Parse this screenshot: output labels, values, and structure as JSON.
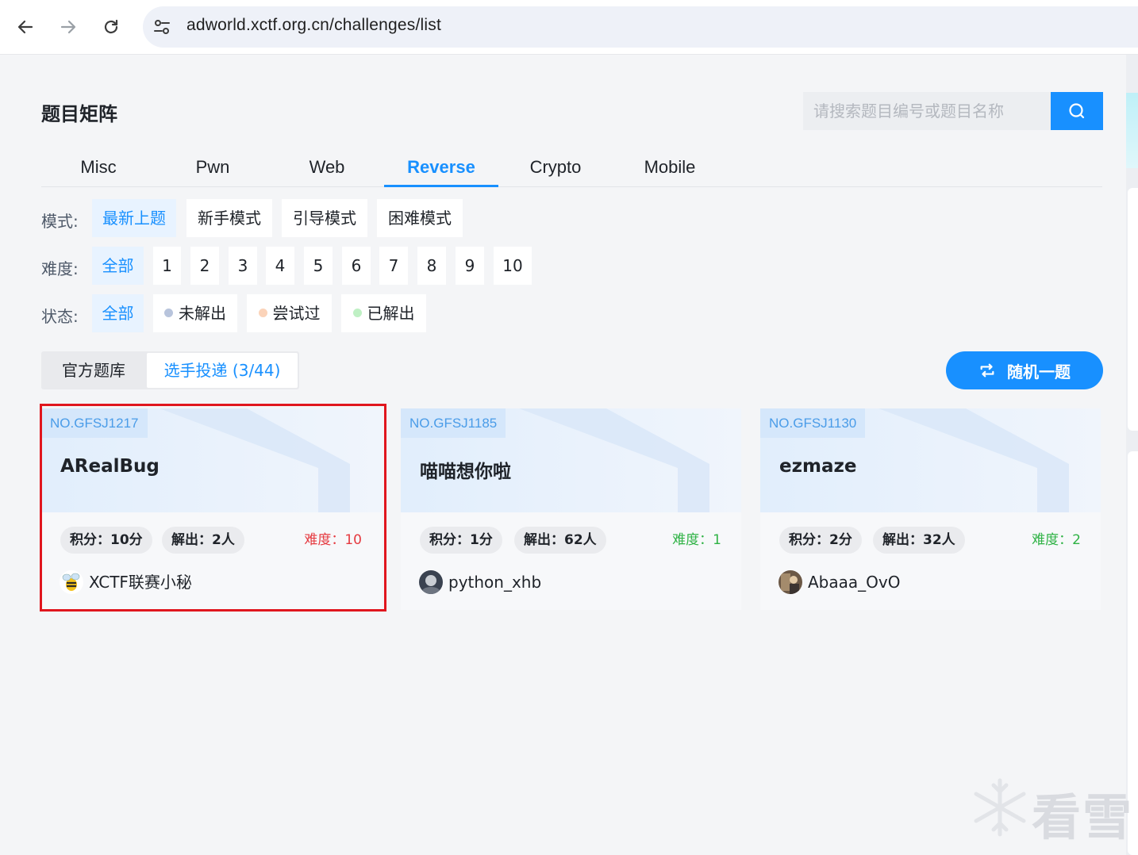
{
  "browser": {
    "url": "adworld.xctf.org.cn/challenges/list"
  },
  "header": {
    "title": "题目矩阵",
    "search_placeholder": "请搜索题目编号或题目名称"
  },
  "tabs": [
    {
      "label": "Misc",
      "active": false
    },
    {
      "label": "Pwn",
      "active": false
    },
    {
      "label": "Web",
      "active": false
    },
    {
      "label": "Reverse",
      "active": true
    },
    {
      "label": "Crypto",
      "active": false
    },
    {
      "label": "Mobile",
      "active": false
    }
  ],
  "filters": {
    "mode": {
      "label": "模式:",
      "options": [
        "最新上题",
        "新手模式",
        "引导模式",
        "困难模式"
      ],
      "selected": "最新上题"
    },
    "difficulty": {
      "label": "难度:",
      "options": [
        "全部",
        "1",
        "2",
        "3",
        "4",
        "5",
        "6",
        "7",
        "8",
        "9",
        "10"
      ],
      "selected": "全部"
    },
    "status": {
      "label": "状态:",
      "options": [
        {
          "text": "全部",
          "dot_color": ""
        },
        {
          "text": "未解出",
          "dot_color": "#b8c4dc"
        },
        {
          "text": "尝试过",
          "dot_color": "#fbd3b9"
        },
        {
          "text": "已解出",
          "dot_color": "#bff0c4"
        }
      ],
      "selected": "全部"
    }
  },
  "source": {
    "official_label": "官方题库",
    "player_label": "选手投递 (3/44)"
  },
  "random_button": {
    "label": "随机一题",
    "icon": "shuffle-icon"
  },
  "cards": [
    {
      "no": "NO.GFSJ1217",
      "title": "ARealBug",
      "score": "积分：10分",
      "solves": "解出：2人",
      "difficulty": "难度：10",
      "difficulty_color": "#e5393f",
      "author": "XCTF联赛小秘",
      "highlighted": true
    },
    {
      "no": "NO.GFSJ1185",
      "title": "喵喵想你啦",
      "score": "积分：1分",
      "solves": "解出：62人",
      "difficulty": "难度：1",
      "difficulty_color": "#2eb244",
      "author": "python_xhb",
      "highlighted": false
    },
    {
      "no": "NO.GFSJ1130",
      "title": "ezmaze",
      "score": "积分：2分",
      "solves": "解出：32人",
      "difficulty": "难度：2",
      "difficulty_color": "#2eb244",
      "author": "Abaaa_OvO",
      "highlighted": false
    }
  ],
  "watermark": {
    "text": "看雪"
  },
  "colors": {
    "accent": "#1890ff",
    "highlight_border": "#e0161e"
  }
}
